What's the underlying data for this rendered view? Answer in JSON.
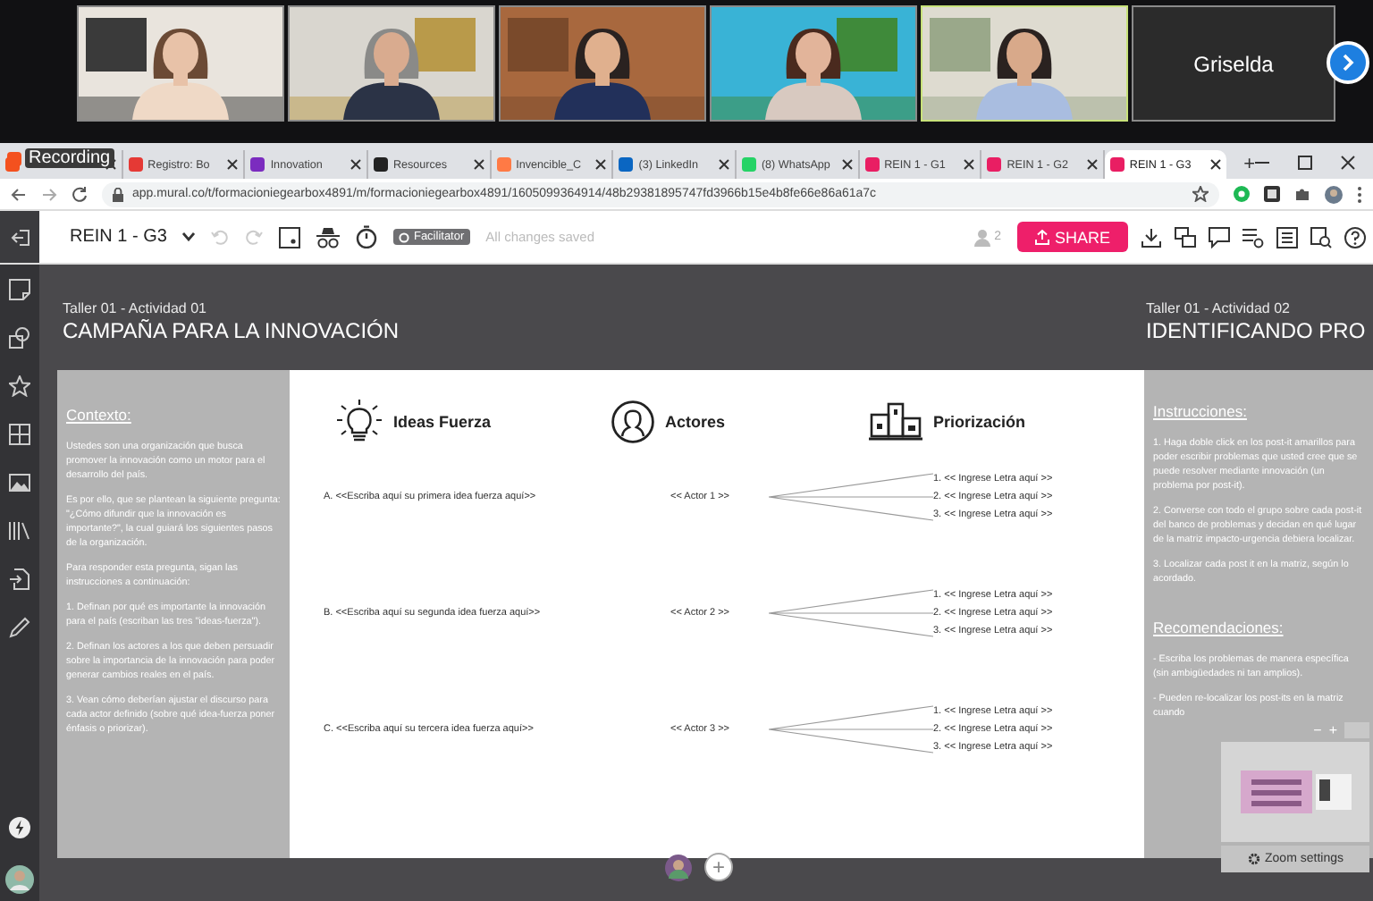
{
  "video_call": {
    "participants": [
      {
        "kind": "video",
        "speaking": false
      },
      {
        "kind": "video",
        "speaking": false
      },
      {
        "kind": "video",
        "speaking": false
      },
      {
        "kind": "video",
        "speaking": false
      },
      {
        "kind": "video",
        "speaking": true
      },
      {
        "kind": "name",
        "name": "Griselda",
        "speaking": false
      }
    ]
  },
  "browser": {
    "recording_label": "Recording",
    "tabs": [
      {
        "color": "#f4511e",
        "selected": false
      },
      {
        "title": "Registro: Bo",
        "color": "#e53935",
        "selected": false
      },
      {
        "title": "Innovation",
        "color": "#7b2cbf",
        "selected": false
      },
      {
        "title": "Resources",
        "color": "#222222",
        "selected": false
      },
      {
        "title": "Invencible_C",
        "color": "#ff7a45",
        "selected": false
      },
      {
        "title": "(3) LinkedIn",
        "color": "#0a66c2",
        "selected": false
      },
      {
        "title": "(8) WhatsApp",
        "color": "#25d366",
        "selected": false
      },
      {
        "title": "REIN 1 - G1",
        "color": "#e91e63",
        "selected": false
      },
      {
        "title": "REIN 1 - G2",
        "color": "#e91e63",
        "selected": false
      },
      {
        "title": "REIN 1 - G3",
        "color": "#e91e63",
        "selected": true
      }
    ],
    "new_tab": "+",
    "url": "app.mural.co/t/formacioniegearbox4891/m/formacioniegearbox4891/1605099364914/48b29381895747fd3966b15e4b8fe66e86a61a7c"
  },
  "toolbar": {
    "board_title": "REIN 1 - G3",
    "facilitator": "Facilitator",
    "save_status": "All changes saved",
    "user_count": "2",
    "share": "SHARE"
  },
  "canvas": {
    "activities": [
      {
        "label": "Taller 01 - Actividad 01",
        "title": "CAMPAÑA PARA LA INNOVACIÓN"
      },
      {
        "label": "Taller 01 - Actividad 02",
        "title": "IDENTIFICANDO PRO"
      }
    ],
    "context_panel": {
      "heading": "Contexto:",
      "paragraphs": [
        "Ustedes son una organización que busca promover la innovación como un motor para el desarrollo del país.",
        "Es por ello, que se plantean la siguiente pregunta: \"¿Cómo difundir que la innovación es importante?\", la cual guiará los siguientes pasos de la organización.",
        "Para responder esta pregunta, sigan las instrucciones a continuación:",
        "1. Definan por qué es importante la innovación para el país (escriban las tres \"ideas-fuerza\").",
        "2. Definan los actores a los que deben persuadir sobre la importancia de la innovación para poder generar cambios reales en el país.",
        "3. Vean cómo deberían ajustar el discurso para cada actor definido (sobre qué idea-fuerza poner énfasis o priorizar)."
      ]
    },
    "board": {
      "columns": [
        {
          "kind": "idea",
          "title": "Ideas Fuerza"
        },
        {
          "kind": "actor",
          "title": "Actores"
        },
        {
          "kind": "priority",
          "title": "Priorización"
        }
      ],
      "rows": [
        {
          "idea": "A. <<Escriba aquí su primera idea fuerza aquí>>",
          "actor": "<< Actor 1 >>",
          "priorities": [
            "1. << Ingrese Letra aquí >>",
            "2. << Ingrese Letra aquí >>",
            "3. << Ingrese Letra aquí >>"
          ]
        },
        {
          "idea": "B. <<Escriba aquí su segunda idea fuerza aquí>>",
          "actor": "<< Actor 2 >>",
          "priorities": [
            "1. << Ingrese Letra aquí >>",
            "2. << Ingrese Letra aquí >>",
            "3. << Ingrese Letra aquí >>"
          ]
        },
        {
          "idea": "C. <<Escriba aquí su tercera idea fuerza aquí>>",
          "actor": "<< Actor 3 >>",
          "priorities": [
            "1. << Ingrese Letra aquí >>",
            "2. << Ingrese Letra aquí >>",
            "3. << Ingrese Letra aquí >>"
          ]
        }
      ]
    },
    "instructions_panel": {
      "heading": "Instrucciones:",
      "paragraphs": [
        "1. Haga doble click en los post-it amarillos para poder escribir problemas que usted cree que se puede resolver mediante innovación (un problema por post-it).",
        "2. Converse con todo el grupo sobre cada post-it del banco de problemas y decidan en qué lugar de la matriz impacto-urgencia debiera localizar.",
        "3. Localizar cada post it en la matriz, según lo acordado."
      ],
      "recommendations_heading": "Recomendaciones:",
      "recommendations": [
        "- Escriba los problemas de manera específica (sin ambigüedades ni tan amplios).",
        "- Pueden re-localizar los post-its en la matriz cuando"
      ]
    },
    "minimap": {
      "zoom_out": "−",
      "zoom_in": "+",
      "settings": "Zoom settings"
    },
    "add_button": "+"
  }
}
